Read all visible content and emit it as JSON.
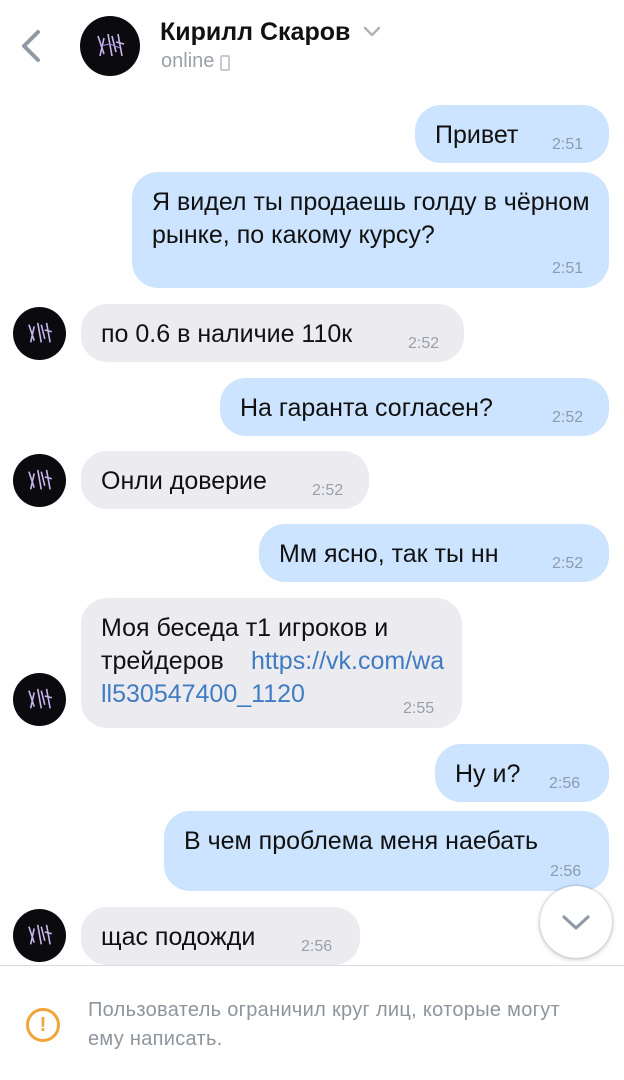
{
  "header": {
    "contact_name": "Кирилл Скаров",
    "status": "online",
    "icons": {
      "back": "chevron-left-icon",
      "dropdown": "chevron-down-icon",
      "device": "phone-icon"
    }
  },
  "messages": [
    {
      "dir": "out",
      "text": "Привет",
      "time": "2:51"
    },
    {
      "dir": "out",
      "text": "Я видел ты продаешь голду в чёрном рынке, по какому курсу?",
      "time": "2:51"
    },
    {
      "dir": "in",
      "text": "по 0.6 в наличие 110к",
      "time": "2:52"
    },
    {
      "dir": "out",
      "text": "На гаранта согласен?",
      "time": "2:52"
    },
    {
      "dir": "in",
      "text": "Онли доверие",
      "time": "2:52"
    },
    {
      "dir": "out",
      "text": "Мм ясно, так ты нн",
      "time": "2:52"
    },
    {
      "dir": "in",
      "text": "Моя беседа т1 игроков и трейдеров",
      "link": "https://vk.com/wall530547400_1120",
      "time": "2:55"
    },
    {
      "dir": "out",
      "text": "Ну и?",
      "time": "2:56"
    },
    {
      "dir": "out",
      "text": "В чем проблема меня наебать",
      "time": "2:56"
    },
    {
      "dir": "in",
      "text": "щас подожди",
      "time": "2:56"
    }
  ],
  "footer": {
    "notice": "Пользователь ограничил круг лиц, которые могут ему написать.",
    "icon": "warning-icon"
  },
  "colors": {
    "outgoing_bubble": "#cce4ff",
    "incoming_bubble": "#ececf0",
    "link": "#3f7cc4",
    "warning": "#f0a43a"
  }
}
